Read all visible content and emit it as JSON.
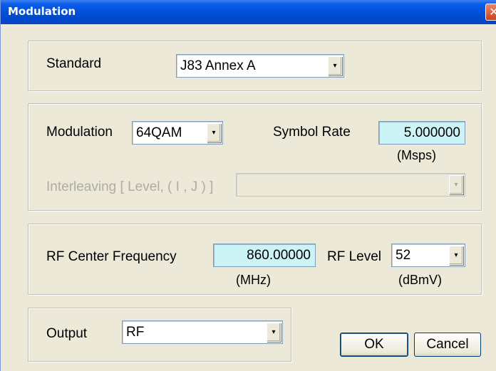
{
  "window": {
    "title": "Modulation",
    "close_glyph": "✕"
  },
  "standard": {
    "label": "Standard",
    "value": "J83 Annex A"
  },
  "modulation_group": {
    "modulation_label": "Modulation",
    "modulation_value": "64QAM",
    "symbol_rate_label": "Symbol Rate",
    "symbol_rate_value": "5.000000",
    "symbol_rate_unit": "(Msps)",
    "interleaving_label": "Interleaving [ Level, ( I , J ) ]",
    "interleaving_value": ""
  },
  "rf_group": {
    "center_freq_label": "RF Center Frequency",
    "center_freq_value": "860.00000",
    "center_freq_unit": "(MHz)",
    "rf_level_label": "RF Level",
    "rf_level_value": "52",
    "rf_level_unit": "(dBmV)"
  },
  "output": {
    "label": "Output",
    "value": "RF"
  },
  "buttons": {
    "ok": "OK",
    "cancel": "Cancel"
  },
  "icons": {
    "dropdown": "chevron-down-icon",
    "close": "close-icon"
  },
  "colors": {
    "titlebar": "#0250d8",
    "dialog_bg": "#ece9d8",
    "numeric_field_bg": "#ccf3f6"
  }
}
